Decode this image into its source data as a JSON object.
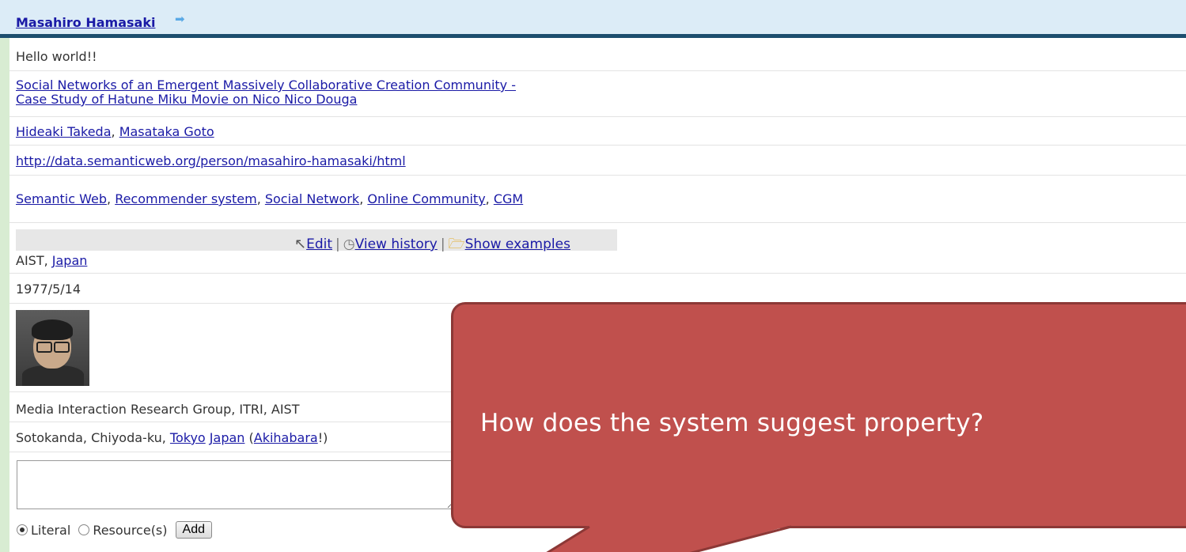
{
  "profile": {
    "name": "Masahiro Hamasaki",
    "greeting": "Hello world!!",
    "paper_line1": "Social Networks of an Emergent Massively Collaborative Creation Community -",
    "paper_line2": "Case Study of Hatune Miku Movie on Nico Nico Douga",
    "coauthor1": "Hideaki Takeda",
    "coauthor2": "Masataka Goto",
    "homepage": "http://data.semanticweb.org/person/masahiro-hamasaki/html",
    "interests": [
      "Semantic Web",
      "Recommender system",
      "Social Network",
      "Online Community",
      "CGM"
    ],
    "affiliation_org": "AIST, ",
    "affiliation_country": "Japan",
    "birthdate": "1977/5/14",
    "group": "Media Interaction Research Group, ITRI, AIST",
    "address_prefix": "Sotokanda, Chiyoda-ku, ",
    "address_city": "Tokyo",
    "address_country": "Japan",
    "address_place": "Akihabara",
    "address_suffix": "!)"
  },
  "toolbar": {
    "edit": "Edit",
    "view_history": "View history",
    "show_examples": "Show examples"
  },
  "input": {
    "literal": "Literal",
    "resource": "Resource(s)",
    "add": "Add"
  },
  "callout": {
    "text": "How does the system suggest property?"
  }
}
